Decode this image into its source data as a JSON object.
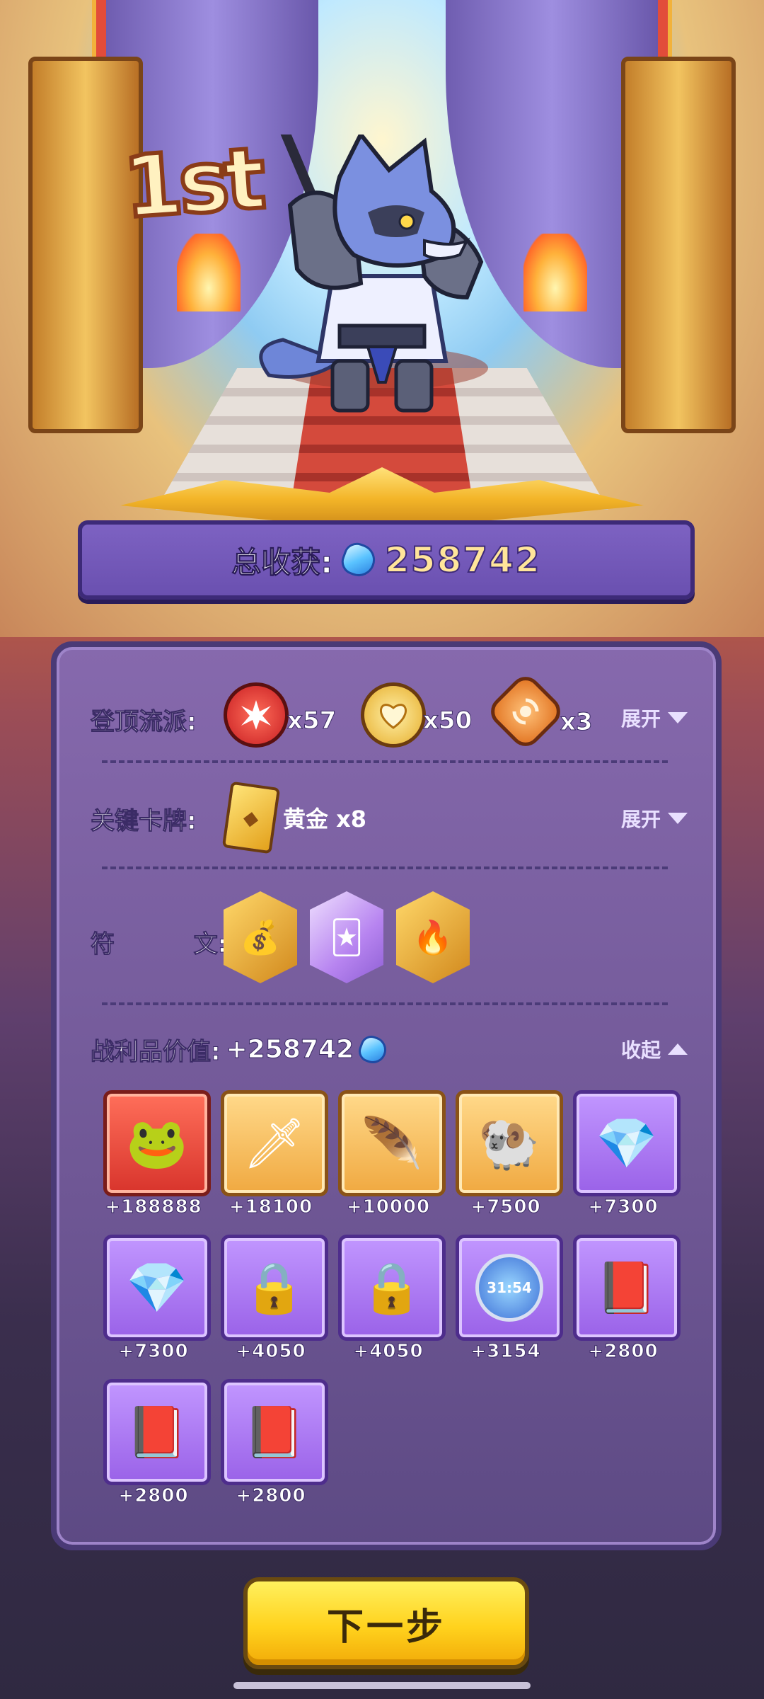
{
  "rank_badge": "1st",
  "total": {
    "label": "总收获:",
    "value": "258742",
    "icon": "blue-gem-icon"
  },
  "build": {
    "label": "登顶流派:",
    "items": [
      {
        "icon": "red-burst-icon",
        "count": "x57"
      },
      {
        "icon": "gold-heart-icon",
        "count": "x50"
      },
      {
        "icon": "swirl-icon",
        "count": "x3"
      }
    ],
    "toggle": "展开"
  },
  "key_cards": {
    "label": "关键卡牌:",
    "card_icon": "gold-card-icon",
    "card_name": "黄金",
    "card_count": "x8",
    "toggle": "展开"
  },
  "runes": {
    "label": "符",
    "label_tail": "文:",
    "items": [
      {
        "icon": "gold-coins-book-icon",
        "style": "gold"
      },
      {
        "icon": "card-upgrade-icon",
        "style": "purple"
      },
      {
        "icon": "flaming-feather-icon",
        "style": "gold"
      }
    ]
  },
  "loot": {
    "label": "战利品价值:",
    "value": "+258742",
    "icon": "blue-gem-icon",
    "toggle": "收起",
    "items": [
      {
        "icon": "jade-frog-icon",
        "frame": "red",
        "value": "+188888"
      },
      {
        "icon": "ornate-dagger-icon",
        "frame": "gold",
        "value": "+18100"
      },
      {
        "icon": "golden-feather-icon",
        "frame": "gold",
        "value": "+10000"
      },
      {
        "icon": "golden-ram-icon",
        "frame": "gold",
        "value": "+7500"
      },
      {
        "icon": "purple-gem-icon",
        "frame": "purple",
        "value": "+7300"
      },
      {
        "icon": "purple-gem-icon",
        "frame": "purple",
        "value": "+7300"
      },
      {
        "icon": "chained-padlock-icon",
        "frame": "purple",
        "value": "+4050"
      },
      {
        "icon": "chained-padlock-icon",
        "frame": "purple",
        "value": "+4050"
      },
      {
        "icon": "stopwatch-icon",
        "frame": "purple",
        "value": "+3154",
        "timer_text": "31:54"
      },
      {
        "icon": "red-book-icon",
        "frame": "purple",
        "value": "+2800"
      },
      {
        "icon": "red-book-icon",
        "frame": "purple",
        "value": "+2800"
      },
      {
        "icon": "red-book-icon",
        "frame": "purple",
        "value": "+2800"
      }
    ]
  },
  "next_button": "下一步"
}
